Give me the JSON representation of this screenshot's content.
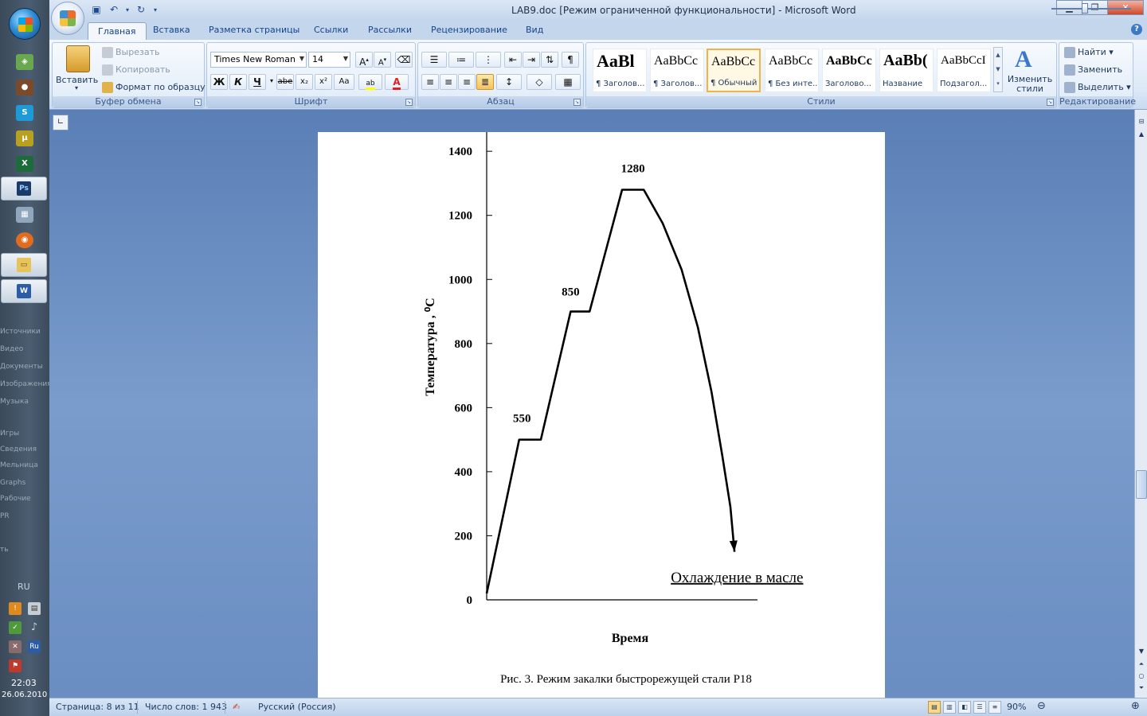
{
  "window": {
    "title": "LAB9.doc [Режим ограниченной функциональности] - Microsoft Word"
  },
  "taskbar": {
    "faded_items": [
      "Источники",
      "Видео",
      "Документы",
      "Изображения",
      "Музыка",
      "Игры",
      "Сведения",
      "Мельница",
      "Graphs",
      "Рабочие",
      "PR",
      "ть"
    ],
    "language": "RU",
    "tray_lang": "Ru",
    "clock_time": "22:03",
    "clock_date": "26.06.2010"
  },
  "tabs": [
    "Главная",
    "Вставка",
    "Разметка страницы",
    "Ссылки",
    "Рассылки",
    "Рецензирование",
    "Вид"
  ],
  "clipboard": {
    "paste": "Вставить",
    "cut": "Вырезать",
    "copy": "Копировать",
    "format_painter": "Формат по образцу",
    "label": "Буфер обмена"
  },
  "font": {
    "name": "Times New Roman",
    "size": "14",
    "bold": "Ж",
    "italic": "К",
    "underline": "Ч",
    "strike": "abe",
    "subscript": "x₂",
    "superscript": "x²",
    "case": "Aa",
    "grow": "A",
    "shrink": "A",
    "color": "A",
    "label": "Шрифт"
  },
  "paragraph": {
    "pilcrow": "¶",
    "label": "Абзац"
  },
  "styles": {
    "items": [
      {
        "sample": "AaBl",
        "name": "¶ Заголов..."
      },
      {
        "sample": "AaBbCc",
        "name": "¶ Заголов..."
      },
      {
        "sample": "AaBbCc",
        "name": "¶ Обычный"
      },
      {
        "sample": "AaBbCc",
        "name": "¶ Без инте..."
      },
      {
        "sample": "AaBbCc",
        "name": "Заголово..."
      },
      {
        "sample": "AaBb(",
        "name": "Название"
      },
      {
        "sample": "AaBbCcI",
        "name": "Подзагол..."
      }
    ],
    "change_styles": "Изменить стили",
    "label": "Стили"
  },
  "editing": {
    "find": "Найти",
    "replace": "Заменить",
    "select": "Выделить",
    "label": "Редактирование"
  },
  "chart_data": {
    "type": "line",
    "ylabel": "Температура , ⁰С",
    "xlabel": "Время",
    "yticks": [
      0,
      200,
      400,
      600,
      800,
      1000,
      1200,
      1400
    ],
    "ylim": [
      0,
      1460
    ],
    "points": [
      {
        "x": 0,
        "y": 20
      },
      {
        "x": 12,
        "y": 500
      },
      {
        "x": 20,
        "y": 500
      },
      {
        "x": 31,
        "y": 900
      },
      {
        "x": 38,
        "y": 900
      },
      {
        "x": 50,
        "y": 1280
      },
      {
        "x": 58,
        "y": 1280
      },
      {
        "x": 65,
        "y": 1175
      },
      {
        "x": 72,
        "y": 1030
      },
      {
        "x": 78,
        "y": 850
      },
      {
        "x": 83,
        "y": 650
      },
      {
        "x": 87,
        "y": 450
      },
      {
        "x": 90,
        "y": 290
      },
      {
        "x": 91.5,
        "y": 150
      }
    ],
    "annotations": [
      {
        "text": "550",
        "x": 13,
        "y": 555
      },
      {
        "text": "850",
        "x": 31,
        "y": 950
      },
      {
        "text": "1280",
        "x": 54,
        "y": 1335
      },
      {
        "text": "Охлаждение в масле",
        "x": 68,
        "y": 55
      }
    ],
    "caption": "Рис. 3. Режим закалки быстрорежущей стали Р18"
  },
  "status": {
    "page": "Страница: 8 из 11",
    "words": "Число слов: 1 943",
    "language": "Русский (Россия)",
    "zoom": "90%"
  }
}
